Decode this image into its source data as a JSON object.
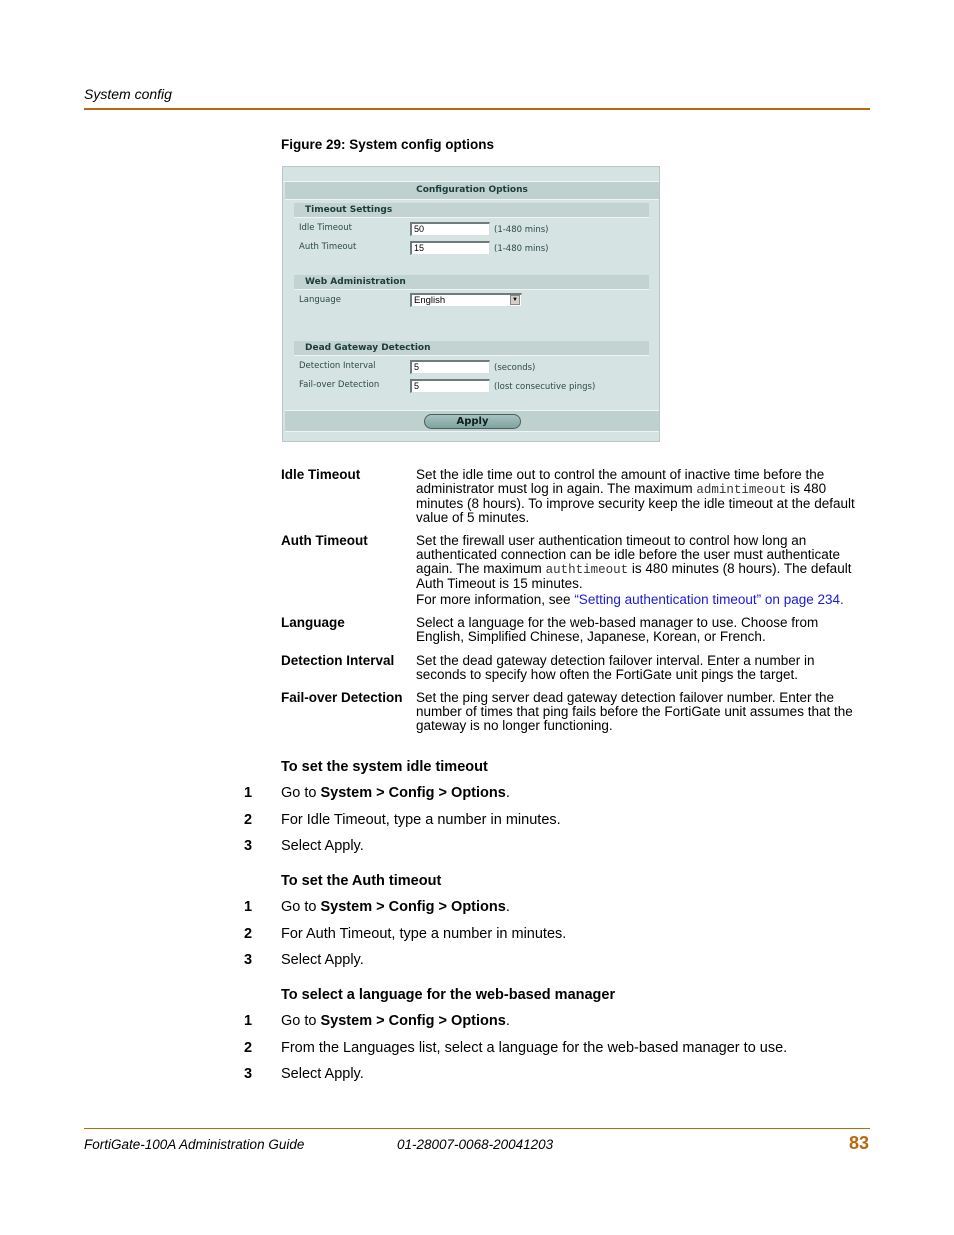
{
  "header": {
    "running_title": "System config"
  },
  "figure": {
    "caption": "Figure 29: System config options",
    "panel": {
      "title": "Configuration Options",
      "sections": [
        {
          "title": "Timeout Settings",
          "fields": [
            {
              "label": "Idle Timeout",
              "value": "50",
              "hint": "(1-480 mins)"
            },
            {
              "label": "Auth Timeout",
              "value": "15",
              "hint": "(1-480 mins)"
            }
          ]
        },
        {
          "title": "Web Administration",
          "fields": [
            {
              "label": "Language",
              "value": "English",
              "type": "select"
            }
          ]
        },
        {
          "title": "Dead Gateway Detection",
          "fields": [
            {
              "label": "Detection Interval",
              "value": "5",
              "hint": "(seconds)"
            },
            {
              "label": "Fail-over Detection",
              "value": "5",
              "hint": "(lost consecutive pings)"
            }
          ]
        }
      ],
      "apply_label": "Apply"
    }
  },
  "definitions": [
    {
      "term": "Idle Timeout",
      "desc_pre": "Set the idle time out to control the amount of inactive time before the administrator must log in again. The maximum ",
      "desc_code": "admintimeout",
      "desc_post": " is 480 minutes (8 hours). To improve security keep the idle timeout at the default value of 5 minutes."
    },
    {
      "term": "Auth Timeout",
      "desc_pre": "Set the firewall user authentication timeout to control how long an authenticated connection can be idle before the user must authenticate again. The maximum ",
      "desc_code": "authtimeout",
      "desc_post": " is 480 minutes (8 hours). The default Auth Timeout is 15 minutes.",
      "more_pre": "For more information, see ",
      "more_link": "“Setting authentication timeout” on page 234",
      "more_post": "."
    },
    {
      "term": "Language",
      "desc": "Select a language for the web-based manager to use. Choose from English, Simplified Chinese, Japanese, Korean, or French."
    },
    {
      "term": "Detection Interval",
      "desc": "Set the dead gateway detection failover interval. Enter a number in seconds to specify how often the FortiGate unit pings the target."
    },
    {
      "term": "Fail-over Detection",
      "desc": "Set the ping server dead gateway detection failover number. Enter the number of times that ping fails before the FortiGate unit assumes that the gateway is no longer functioning."
    }
  ],
  "procedures": [
    {
      "title": "To set the system idle timeout",
      "steps": [
        {
          "num": "1",
          "pre": "Go to ",
          "bold": "System > Config > Options",
          "post": "."
        },
        {
          "num": "2",
          "text": "For Idle Timeout, type a number in minutes."
        },
        {
          "num": "3",
          "text": "Select Apply."
        }
      ]
    },
    {
      "title": "To set the Auth timeout",
      "steps": [
        {
          "num": "1",
          "pre": "Go to ",
          "bold": "System > Config > Options",
          "post": "."
        },
        {
          "num": "2",
          "text": "For Auth Timeout, type a number in minutes."
        },
        {
          "num": "3",
          "text": "Select Apply."
        }
      ]
    },
    {
      "title": "To select a language for the web-based manager",
      "steps": [
        {
          "num": "1",
          "pre": "Go to ",
          "bold": "System > Config > Options",
          "post": "."
        },
        {
          "num": "2",
          "text": "From the Languages list, select a language for the web-based manager to use."
        },
        {
          "num": "3",
          "text": "Select Apply."
        }
      ]
    }
  ],
  "footer": {
    "guide_title": "FortiGate-100A Administration Guide",
    "doc_number": "01-28007-0068-20041203",
    "page_number": "83"
  },
  "colors": {
    "accent": "#b8690f",
    "link": "#1a1ad8",
    "panel_bg": "#d5e4e3",
    "panel_bar": "#c2d3d1"
  }
}
